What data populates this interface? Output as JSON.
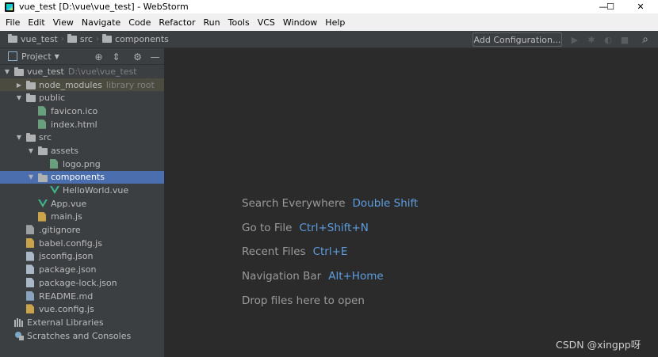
{
  "window": {
    "title": "vue_test [D:\\vue\\vue_test] - WebStorm",
    "icon": "webstorm-icon",
    "controls": [
      "minimize-icon",
      "maximize-icon",
      "close-icon"
    ],
    "minimize_glyph": "—",
    "maximize_glyph": "☐",
    "close_glyph": "✕"
  },
  "menu": {
    "items": [
      "File",
      "Edit",
      "View",
      "Navigate",
      "Code",
      "Refactor",
      "Run",
      "Tools",
      "VCS",
      "Window",
      "Help"
    ]
  },
  "navbar": {
    "breadcrumb": [
      "vue_test",
      "src",
      "components"
    ],
    "separator": "›",
    "add_configuration": "Add Configuration...",
    "run_glyph": "▶",
    "debug_glyph": "✱",
    "coverage_glyph": "◐",
    "stop_glyph": "■",
    "search_glyph": "⌕"
  },
  "project_panel": {
    "title": "Project",
    "dropdown_glyph": "▼",
    "locate_glyph": "⊕",
    "collapse_glyph": "⇕",
    "settings_glyph": "⚙",
    "hide_glyph": "—",
    "tree": [
      {
        "label": "vue_test",
        "hint": "D:\\vue\\vue_test",
        "depth": 0,
        "arrow": "▼",
        "icon": "folder-icon"
      },
      {
        "label": "node_modules",
        "hint": "library root",
        "depth": 1,
        "arrow": "▶",
        "icon": "folder-icon",
        "highlighted": true
      },
      {
        "label": "public",
        "depth": 1,
        "arrow": "▼",
        "icon": "folder-icon"
      },
      {
        "label": "favicon.ico",
        "depth": 2,
        "icon": "image-file-icon"
      },
      {
        "label": "index.html",
        "depth": 2,
        "icon": "html-file-icon"
      },
      {
        "label": "src",
        "depth": 1,
        "arrow": "▼",
        "icon": "folder-icon"
      },
      {
        "label": "assets",
        "depth": 2,
        "arrow": "▼",
        "icon": "folder-icon"
      },
      {
        "label": "logo.png",
        "depth": 3,
        "icon": "image-file-icon"
      },
      {
        "label": "components",
        "depth": 2,
        "arrow": "▼",
        "icon": "folder-icon",
        "selected": true
      },
      {
        "label": "HelloWorld.vue",
        "depth": 3,
        "icon": "vue-file-icon"
      },
      {
        "label": "App.vue",
        "depth": 2,
        "icon": "vue-file-icon"
      },
      {
        "label": "main.js",
        "depth": 2,
        "icon": "js-file-icon"
      },
      {
        "label": ".gitignore",
        "depth": 1,
        "icon": "text-file-icon"
      },
      {
        "label": "babel.config.js",
        "depth": 1,
        "icon": "js-file-icon"
      },
      {
        "label": "jsconfig.json",
        "depth": 1,
        "icon": "json-file-icon"
      },
      {
        "label": "package.json",
        "depth": 1,
        "icon": "json-file-icon"
      },
      {
        "label": "package-lock.json",
        "depth": 1,
        "icon": "json-file-icon"
      },
      {
        "label": "README.md",
        "depth": 1,
        "icon": "markdown-file-icon"
      },
      {
        "label": "vue.config.js",
        "depth": 1,
        "icon": "js-file-icon"
      },
      {
        "label": "External Libraries",
        "depth": 0,
        "icon": "libraries-icon",
        "arrow_hidden": true
      },
      {
        "label": "Scratches and Consoles",
        "depth": 0,
        "icon": "scratches-icon",
        "arrow_hidden": true
      }
    ]
  },
  "editor": {
    "tips": [
      {
        "label": "Search Everywhere",
        "key": "Double Shift"
      },
      {
        "label": "Go to File",
        "key": "Ctrl+Shift+N"
      },
      {
        "label": "Recent Files",
        "key": "Ctrl+E"
      },
      {
        "label": "Navigation Bar",
        "key": "Alt+Home"
      },
      {
        "label": "Drop files here to open",
        "key": ""
      }
    ]
  },
  "watermark": "CSDN @xingpp呀",
  "colors": {
    "selection": "#4b6eaf",
    "library_highlight": "#4b4c3f",
    "shortcut_key": "#5d9de0",
    "panel_bg": "#3c3f41",
    "editor_bg": "#2b2b2b",
    "vue_green": "#41b883"
  }
}
